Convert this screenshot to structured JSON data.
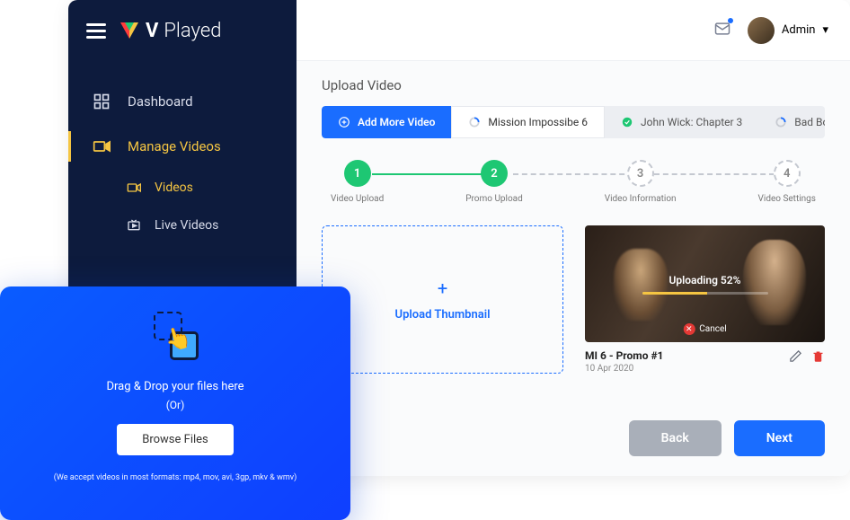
{
  "brand": {
    "name_bold": "V",
    "name_rest": "Played"
  },
  "user": {
    "name": "Admin"
  },
  "sidebar": {
    "dashboard": "Dashboard",
    "manage_videos": "Manage Videos",
    "videos": "Videos",
    "live_videos": "Live Videos"
  },
  "page": {
    "title": "Upload Video"
  },
  "tabs": {
    "add": "Add More Video",
    "t1": "Mission Impossibe 6",
    "t2": "John Wick: Chapter 3",
    "t3": "Bad Boys For Life"
  },
  "steps": {
    "s1": {
      "num": "1",
      "label": "Video Upload"
    },
    "s2": {
      "num": "2",
      "label": "Promo Upload"
    },
    "s3": {
      "num": "3",
      "label": "Video Information"
    },
    "s4": {
      "num": "4",
      "label": "Video Settings"
    }
  },
  "dropzone": {
    "label": "Upload Thumbnail"
  },
  "uploading": {
    "prefix": "Uploading",
    "percent": "52%",
    "progress_width": "52%",
    "cancel": "Cancel"
  },
  "video": {
    "title": "MI 6 - Promo #1",
    "date": "10 Apr 2020"
  },
  "footer": {
    "back": "Back",
    "next": "Next"
  },
  "popup": {
    "line1": "Drag & Drop your files here",
    "or": "(Or)",
    "browse": "Browse Files",
    "note": "(We accept videos in most formats: mp4, mov, avi, 3gp, mkv & wmv)"
  }
}
